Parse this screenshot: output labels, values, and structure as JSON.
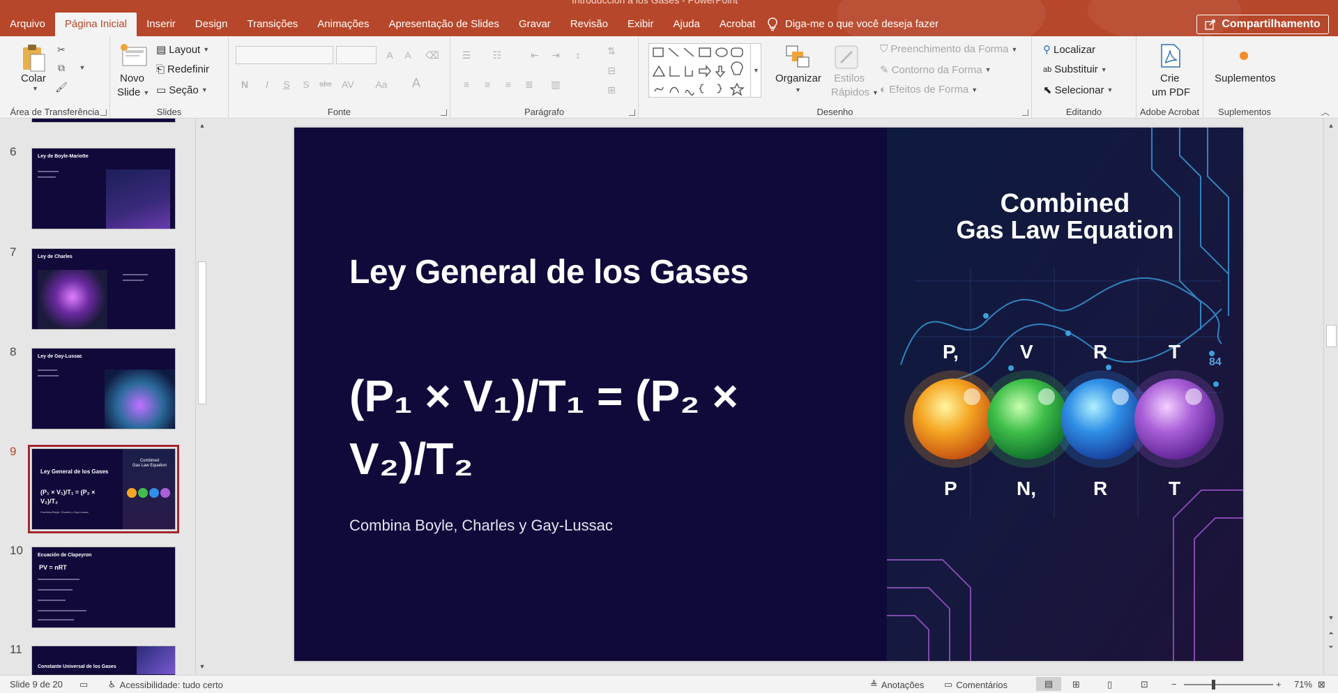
{
  "window": {
    "title_fragment": "Introducción a los Gases - PowerPoint"
  },
  "tabs": [
    {
      "label": "Arquivo"
    },
    {
      "label": "Página Inicial",
      "active": true
    },
    {
      "label": "Inserir"
    },
    {
      "label": "Design"
    },
    {
      "label": "Transições"
    },
    {
      "label": "Animações"
    },
    {
      "label": "Apresentação de Slides"
    },
    {
      "label": "Gravar"
    },
    {
      "label": "Revisão"
    },
    {
      "label": "Exibir"
    },
    {
      "label": "Ajuda"
    },
    {
      "label": "Acrobat"
    }
  ],
  "tellme": {
    "label": "Diga-me o que você deseja fazer",
    "icon": "lightbulb-icon"
  },
  "share": {
    "label": "Compartilhamento",
    "icon": "share-icon"
  },
  "ribbon": {
    "clipboard": {
      "label": "Área de Transferência",
      "paste": "Colar"
    },
    "slides": {
      "label": "Slides",
      "new_slide_1": "Novo",
      "new_slide_2": "Slide",
      "layout": "Layout",
      "reset": "Redefinir",
      "section": "Seção"
    },
    "font": {
      "label": "Fonte"
    },
    "paragraph": {
      "label": "Parágrafo"
    },
    "drawing": {
      "label": "Desenho",
      "arrange": "Organizar",
      "quick_styles_1": "Estilos",
      "quick_styles_2": "Rápidos",
      "fill": "Preenchimento da Forma",
      "outline": "Contorno da Forma",
      "effects": "Efeitos de Forma"
    },
    "editing": {
      "label": "Editando",
      "find": "Localizar",
      "replace": "Substituir",
      "select": "Selecionar"
    },
    "acrobat": {
      "label": "Adobe Acrobat",
      "create_1": "Crie",
      "create_2": "um PDF"
    },
    "addins": {
      "label": "Suplementos",
      "button": "Suplementos"
    }
  },
  "thumbnails": [
    {
      "number": "6",
      "title": "Ley de Boyle-Mariotte",
      "image": "boyle"
    },
    {
      "number": "7",
      "title": "Ley de Charles",
      "image": "charles"
    },
    {
      "number": "8",
      "title": "Ley de Gay-Lussac",
      "image": "gaylussac"
    },
    {
      "number": "9",
      "title": "Ley General de los Gases",
      "formula": "(P₁ × V₁)/T₁ = (P₂ × V₂)/T₂",
      "subtitle": "Combina Boyle, Charles y Gay-Lussac",
      "active": true
    },
    {
      "number": "10",
      "title": "Ecuación de Clapeyron",
      "formula": "PV = nRT"
    },
    {
      "number": "11",
      "title": "Constante Universal de los Gases"
    }
  ],
  "slide": {
    "title": "Ley General de los Gases",
    "formula_line1": "(P₁ × V₁)/T₁ = (P₂ ×",
    "formula_line2": "V₂)/T₂",
    "subtitle": "Combina Boyle, Charles y Gay-Lussac",
    "image": {
      "title_line1": "Combined",
      "title_line2": "Gas Law Equation",
      "top_labels": [
        "P,",
        "V",
        "R",
        "T"
      ],
      "bottom_labels": [
        "P",
        "N,",
        "R",
        "T"
      ],
      "corner_number": "84",
      "orb_colors": [
        "#f5a623",
        "#3fbf4a",
        "#2f8fe6",
        "#a95fd8"
      ]
    }
  },
  "status": {
    "slide_counter": "Slide 9 de 20",
    "accessibility": "Acessibilidade: tudo certo",
    "notes": "Anotações",
    "comments": "Comentários",
    "zoom": "71%"
  }
}
